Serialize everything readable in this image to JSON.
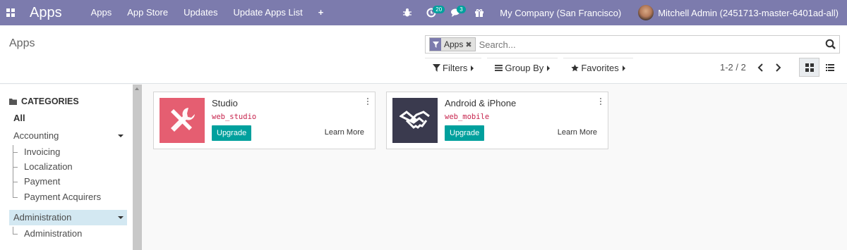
{
  "navbar": {
    "brand": "Apps",
    "menu": [
      "Apps",
      "App Store",
      "Updates",
      "Update Apps List"
    ],
    "plus": "+",
    "activity_count": "20",
    "messages_count": "3",
    "company": "My Company (San Francisco)",
    "user": "Mitchell Admin (2451713-master-6401ad-all)"
  },
  "control_panel": {
    "breadcrumb": "Apps",
    "search": {
      "facet_value": "Apps",
      "facet_remove": "✖",
      "placeholder": "Search..."
    },
    "filters_label": "Filters",
    "group_by_label": "Group By",
    "favorites_label": "Favorites",
    "pager": "1-2 / 2"
  },
  "sidebar": {
    "title": "CATEGORIES",
    "all": "All",
    "accounting": "Accounting",
    "accounting_children": [
      "Invoicing",
      "Localization",
      "Payment",
      "Payment Acquirers"
    ],
    "administration": "Administration",
    "administration_children": [
      "Administration"
    ]
  },
  "apps": [
    {
      "name": "Studio",
      "technical": "web_studio",
      "action": "Upgrade",
      "learn": "Learn More",
      "icon": "tools-icon",
      "color": "#e55e71"
    },
    {
      "name": "Android & iPhone",
      "technical": "web_mobile",
      "action": "Upgrade",
      "learn": "Learn More",
      "icon": "handshake-icon",
      "color": "#3a3a4e"
    }
  ],
  "colors": {
    "navbar": "#7c7bad",
    "primary": "#00a09d",
    "active_category": "#d3e8f2"
  }
}
